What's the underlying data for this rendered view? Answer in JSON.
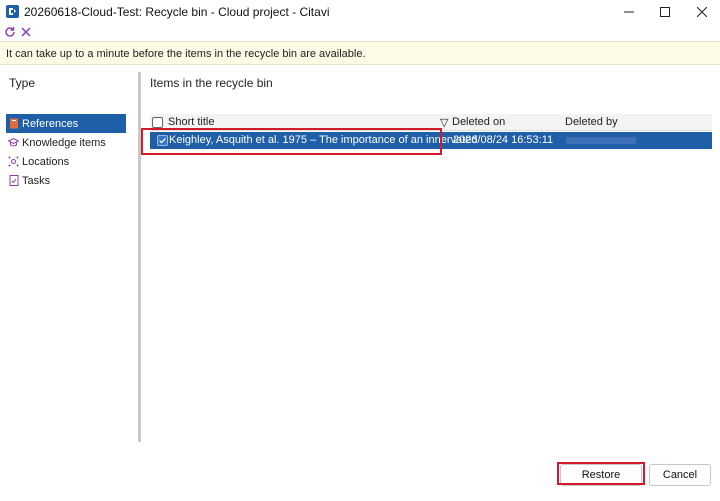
{
  "window": {
    "title": "20260618-Cloud-Test: Recycle bin - Cloud project - Citavi",
    "minimize_glyph": "–",
    "maximize_glyph": "□",
    "close_glyph": "✕"
  },
  "toolbar": {
    "refresh_icon": "refresh-icon",
    "delete_icon": "close-icon",
    "accent": "#8c3fa8"
  },
  "infobar": {
    "message": "It can take up to a minute before the items in the recycle bin are available."
  },
  "left_pane": {
    "heading": "Type",
    "items": [
      {
        "label": "References",
        "icon": "reference-icon",
        "selected": true
      },
      {
        "label": "Knowledge items",
        "icon": "knowledge-icon",
        "selected": false
      },
      {
        "label": "Locations",
        "icon": "locations-icon",
        "selected": false
      },
      {
        "label": "Tasks",
        "icon": "tasks-icon",
        "selected": false
      }
    ]
  },
  "right_pane": {
    "heading": "Items in the recycle bin",
    "columns": {
      "short_title": "Short title",
      "deleted_on": "Deleted on",
      "deleted_by": "Deleted by",
      "sort_glyph": "▽"
    },
    "rows": [
      {
        "short_title": "Keighley, Asquith et al. 1975 – The importance of an innervated",
        "deleted_on": "2026/08/24 16:53:11",
        "checked": true,
        "selected": true
      }
    ]
  },
  "buttons": {
    "restore": "Restore",
    "cancel": "Cancel"
  },
  "colors": {
    "selection": "#1f5fa8",
    "highlight": "#d11a2a",
    "infobar_bg": "#fdfbe6"
  }
}
